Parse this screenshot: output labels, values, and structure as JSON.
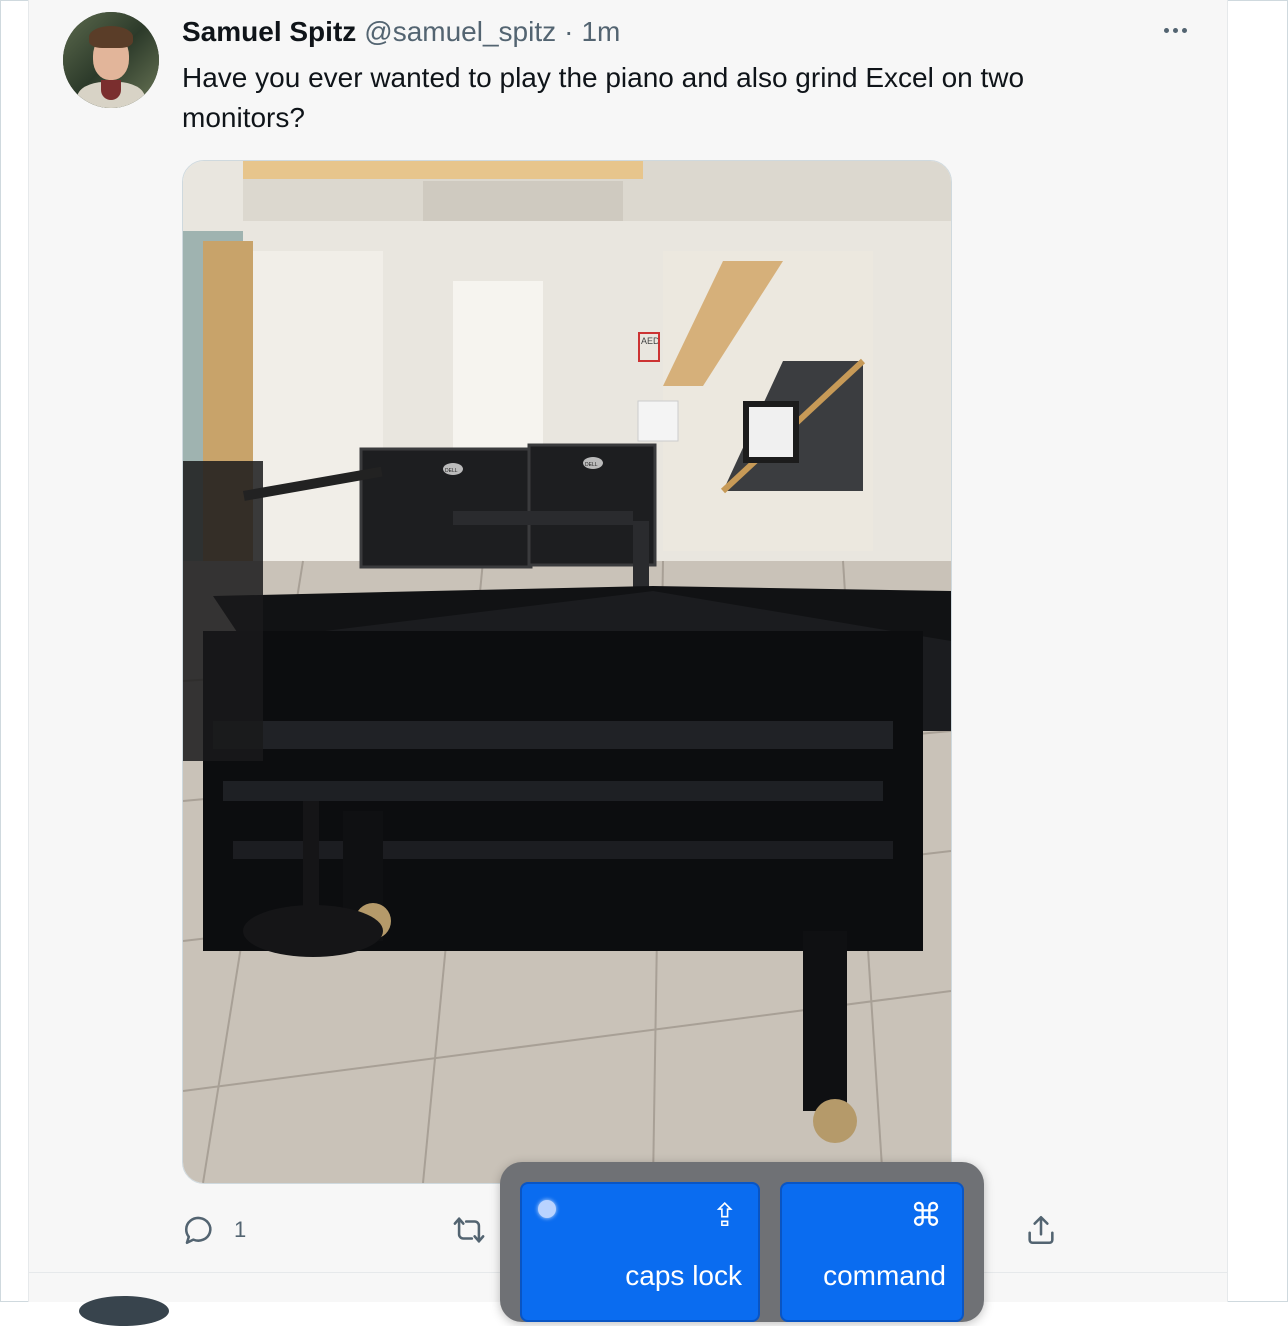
{
  "tweet": {
    "author_name": "Samuel Spitz",
    "author_handle": "@samuel_spitz",
    "separator": "·",
    "time": "1m",
    "text": "Have you ever wanted to play the piano and also grind Excel on two monitors?",
    "photo": {
      "monitor_brand": "DELL",
      "sign_text": "AED"
    },
    "actions": {
      "reply_count": "1"
    }
  },
  "keys": {
    "caps_lock_label": "caps lock",
    "caps_lock_symbol": "⇪",
    "command_label": "command",
    "command_symbol": "⌘"
  },
  "colors": {
    "key_blue": "#0a6cf0",
    "text_primary": "#0f1419",
    "text_secondary": "#536471"
  }
}
